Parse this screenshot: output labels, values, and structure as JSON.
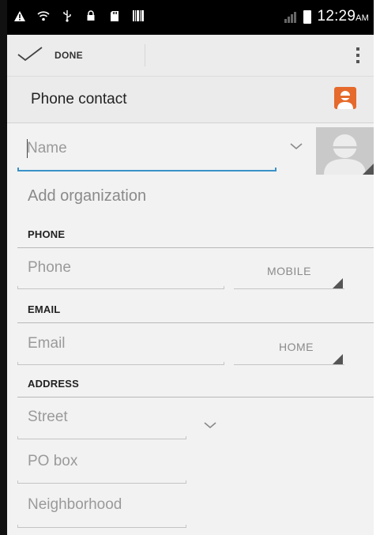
{
  "status_bar": {
    "icons": [
      "warning-icon",
      "wifi-icon",
      "usb-icon",
      "lock-icon",
      "sd-card-icon",
      "barcode-icon",
      "signal-icon",
      "battery-icon"
    ],
    "time": "12:29",
    "ampm": "AM"
  },
  "action_bar": {
    "done_label": "DONE",
    "icons": [
      "check-icon",
      "overflow-menu-icon"
    ]
  },
  "account": {
    "label": "Phone contact",
    "icon": "contact-person-icon",
    "icon_color": "#e56a2c"
  },
  "name": {
    "placeholder": "Name",
    "accent_color": "#3a92c8"
  },
  "add_organization": "Add organization",
  "phone": {
    "section": "PHONE",
    "placeholder": "Phone",
    "type": "MOBILE"
  },
  "email": {
    "section": "EMAIL",
    "placeholder": "Email",
    "type": "HOME"
  },
  "address": {
    "section": "ADDRESS",
    "street": "Street",
    "po_box": "PO box",
    "neighborhood": "Neighborhood"
  }
}
